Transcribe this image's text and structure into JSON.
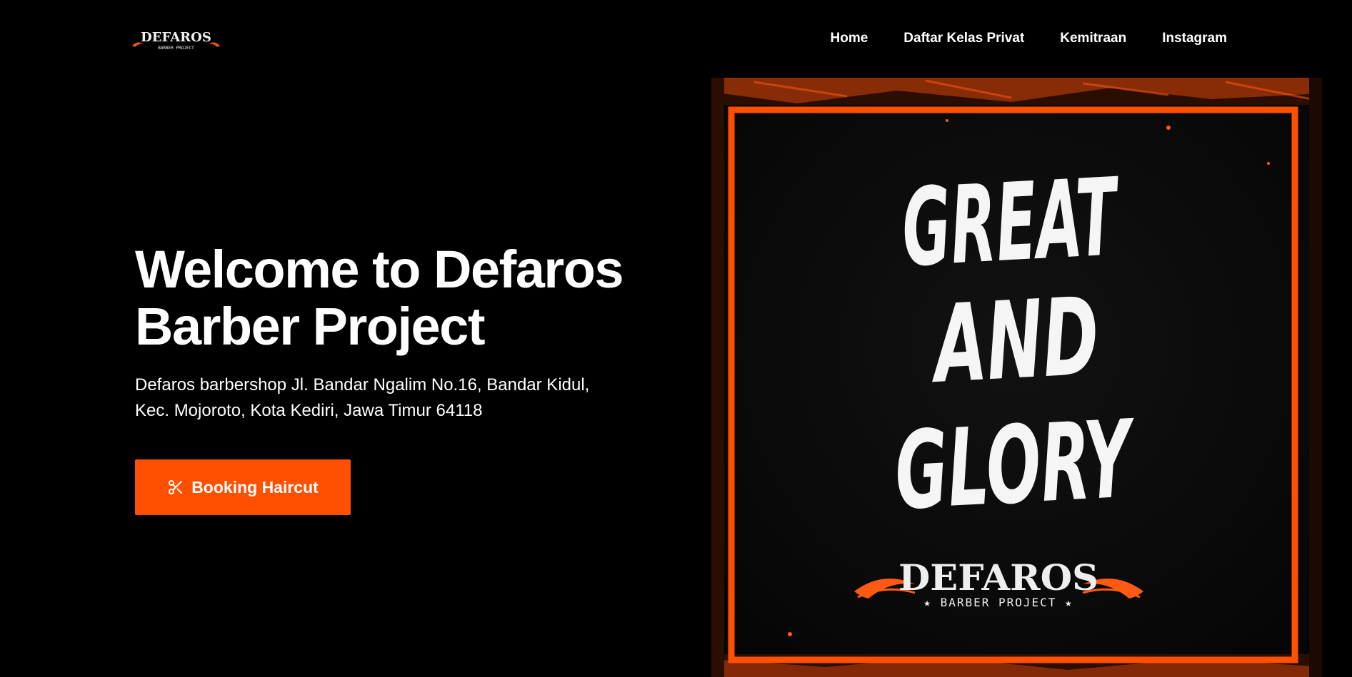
{
  "brand": {
    "logo_text": "DEFAROS",
    "logo_subtext": "BARBER PROJECT"
  },
  "nav": {
    "items": [
      {
        "label": "Home"
      },
      {
        "label": "Daftar Kelas Privat"
      },
      {
        "label": "Kemitraan"
      },
      {
        "label": "Instagram"
      }
    ]
  },
  "hero": {
    "title": "Welcome to Defaros Barber Project",
    "address": "Defaros barbershop Jl. Bandar Ngalim No.16, Bandar Kidul, Kec. Mojoroto, Kota Kediri, Jawa Timur 64118",
    "button_label": "Booking Haircut",
    "button_icon": "scissors-icon"
  },
  "poster": {
    "line1": "GREAT",
    "line2": "AND",
    "line3": "GLORY",
    "brand": "DEFAROS",
    "subbrand": "★ BARBER PROJECT ★"
  },
  "colors": {
    "background": "#000000",
    "accent": "#ff4f00",
    "text": "#ffffff"
  }
}
